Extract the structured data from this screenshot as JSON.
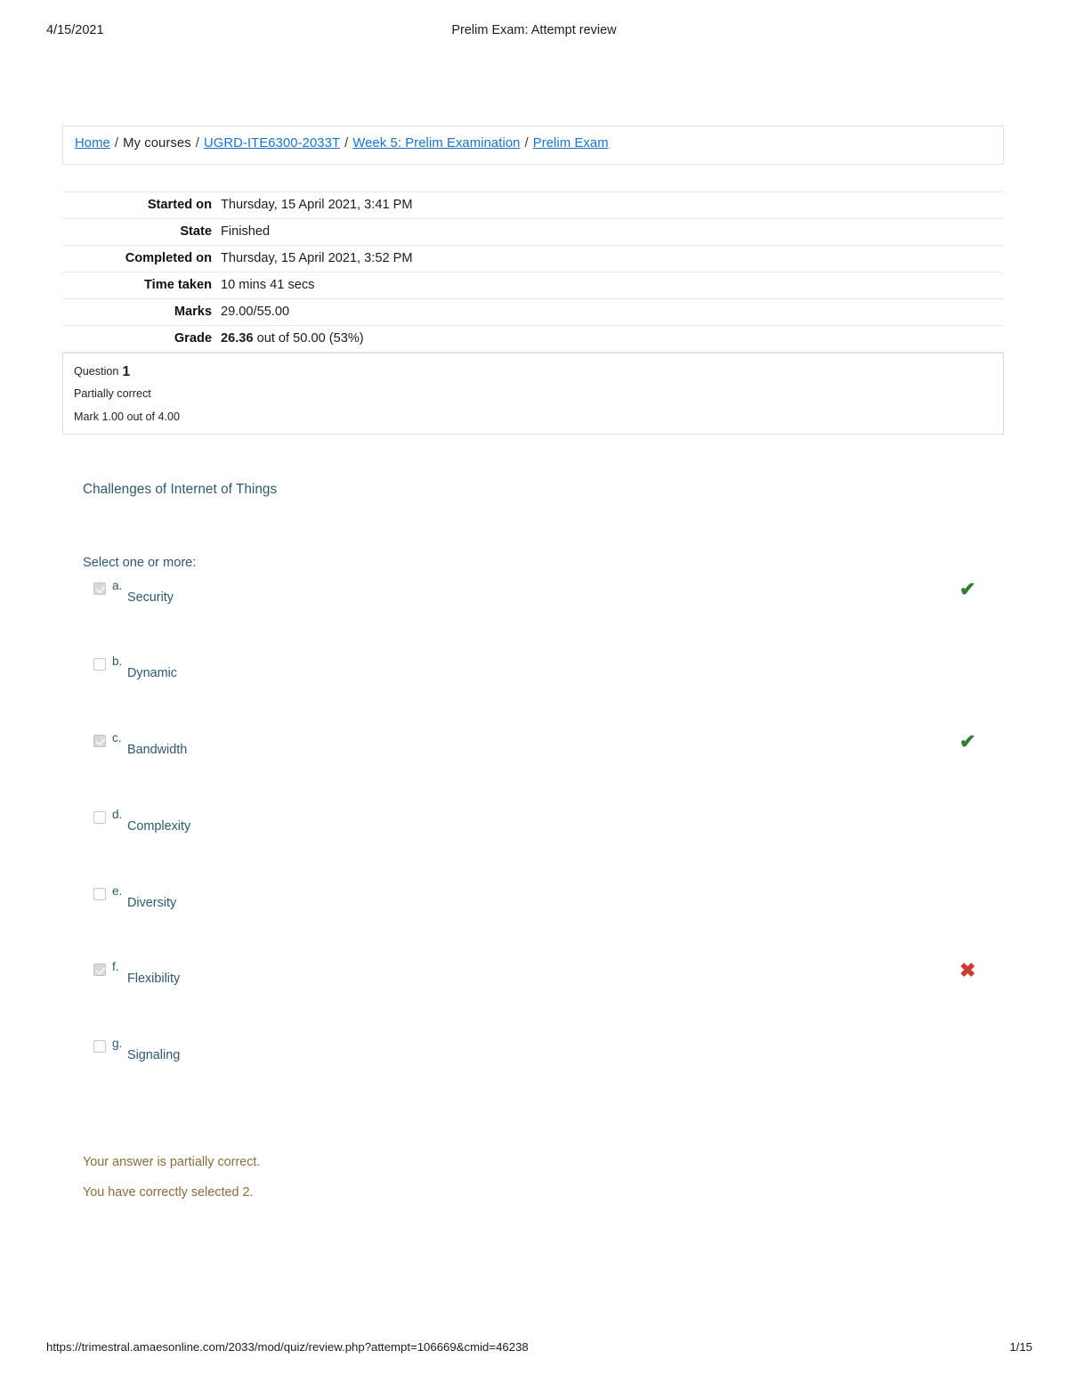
{
  "print_header": {
    "date": "4/15/2021",
    "title": "Prelim Exam: Attempt review"
  },
  "breadcrumb": {
    "items": [
      {
        "label": "Home",
        "link": true
      },
      {
        "label": "My courses",
        "link": false
      },
      {
        "label": "UGRD-ITE6300-2033T",
        "link": true
      },
      {
        "label": "Week 5: Prelim Examination",
        "link": true
      },
      {
        "label": "Prelim Exam",
        "link": true
      }
    ],
    "separator": "/"
  },
  "summary": {
    "rows": [
      {
        "label": "Started on",
        "value": "Thursday, 15 April 2021, 3:41 PM"
      },
      {
        "label": "State",
        "value": "Finished"
      },
      {
        "label": "Completed on",
        "value": "Thursday, 15 April 2021, 3:52 PM"
      },
      {
        "label": "Time taken",
        "value": "10 mins 41 secs"
      },
      {
        "label": "Marks",
        "value": "29.00/55.00"
      }
    ],
    "grade_row": {
      "label": "Grade",
      "value_strong": "26.36",
      "value_rest": "out of 50.00 (53%)"
    }
  },
  "question_info": {
    "question_word": "Question",
    "number": "1",
    "state": "Partially correct",
    "mark": "Mark 1.00 out of 4.00"
  },
  "question": {
    "text": "Challenges of Internet of Things",
    "prompt": "Select one or more:",
    "options": [
      {
        "letter": "a.",
        "text": "Security",
        "checked": true,
        "grade": "correct",
        "grade_glyph": "✔"
      },
      {
        "letter": "b.",
        "text": "Dynamic",
        "checked": false,
        "grade": "none",
        "grade_glyph": ""
      },
      {
        "letter": "c.",
        "text": "Bandwidth",
        "checked": true,
        "grade": "correct",
        "grade_glyph": "✔"
      },
      {
        "letter": "d.",
        "text": "Complexity",
        "checked": false,
        "grade": "none",
        "grade_glyph": ""
      },
      {
        "letter": "e.",
        "text": "Diversity",
        "checked": false,
        "grade": "none",
        "grade_glyph": ""
      },
      {
        "letter": "f.",
        "text": "Flexibility",
        "checked": true,
        "grade": "incorrect",
        "grade_glyph": "✖"
      },
      {
        "letter": "g.",
        "text": "Signaling",
        "checked": false,
        "grade": "none",
        "grade_glyph": ""
      }
    ]
  },
  "feedback": {
    "line1": "Your answer is partially correct.",
    "line2": "You have correctly selected 2."
  },
  "print_footer": {
    "url": "https://trimestral.amaesonline.com/2033/mod/quiz/review.php?attempt=106669&cmid=46238",
    "page": "1/15"
  },
  "colors": {
    "link": "#1a73c8",
    "question_text": "#2c5a6b",
    "correct": "#2f7d32",
    "incorrect": "#cd3a2e",
    "feedback": "#8a6d3b"
  }
}
